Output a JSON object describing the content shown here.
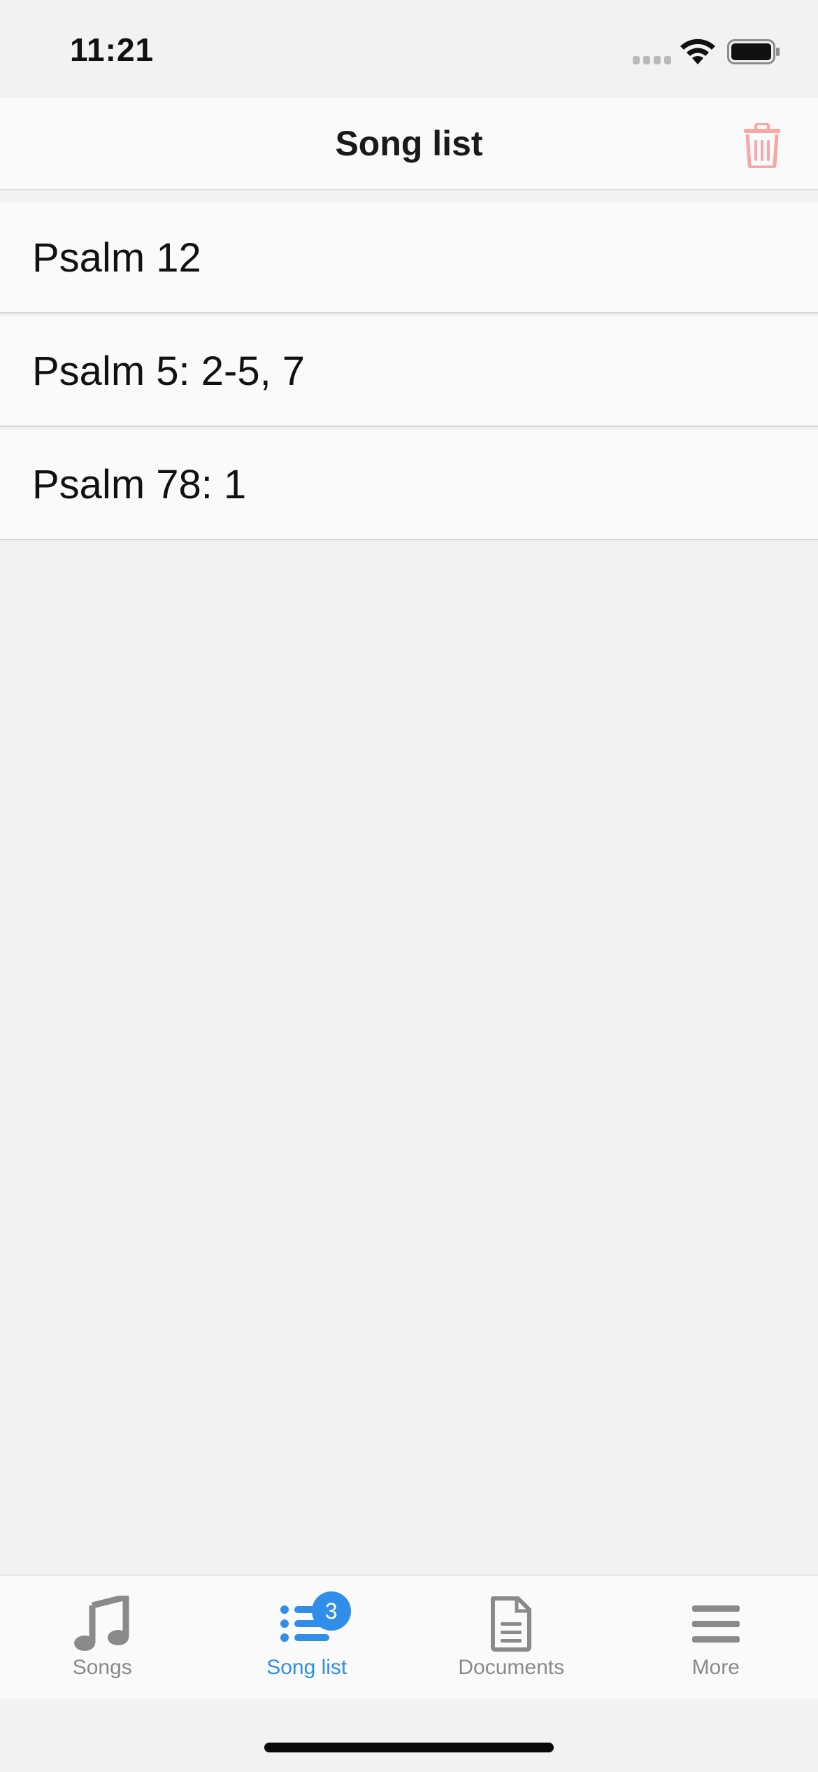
{
  "status_bar": {
    "time": "11:21"
  },
  "header": {
    "title": "Song list",
    "trash_icon": "trash-icon",
    "trash_color": "#f8a6a6"
  },
  "songs": [
    {
      "title": "Psalm 12"
    },
    {
      "title": "Psalm 5: 2-5, 7"
    },
    {
      "title": "Psalm 78: 1"
    }
  ],
  "tab_bar": {
    "tabs": [
      {
        "label": "Songs",
        "icon": "music-note-icon",
        "active": false
      },
      {
        "label": "Song list",
        "icon": "list-icon",
        "active": true,
        "badge": "3"
      },
      {
        "label": "Documents",
        "icon": "document-icon",
        "active": false
      },
      {
        "label": "More",
        "icon": "menu-icon",
        "active": false
      }
    ],
    "active_color": "#2f8ee8",
    "inactive_color": "#8a8a8a"
  }
}
